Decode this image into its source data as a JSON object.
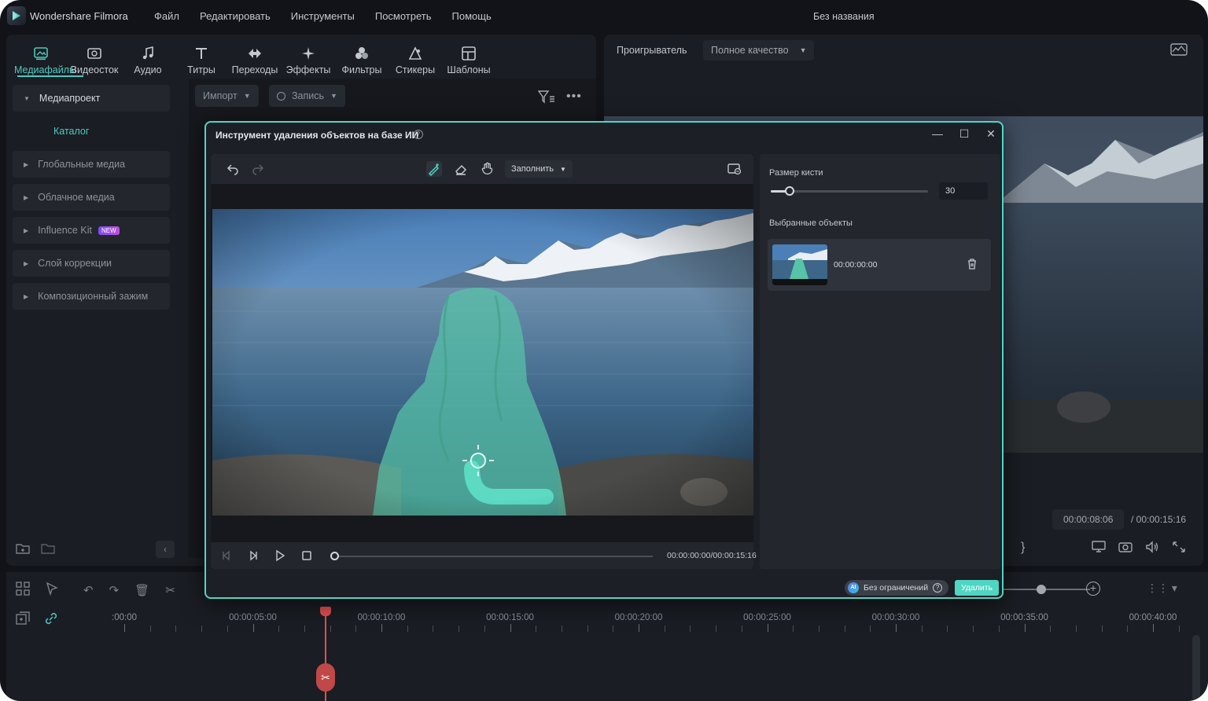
{
  "app": {
    "name": "Wondershare Filmora",
    "menu": [
      "Файл",
      "Редактировать",
      "Инструменты",
      "Посмотреть",
      "Помощь"
    ],
    "doc_title": "Без названия"
  },
  "toolbar_tabs": [
    {
      "label": "Медиафайлы",
      "icon": "media-icon",
      "active": true
    },
    {
      "label": "Видеосток",
      "icon": "stock-video-icon"
    },
    {
      "label": "Аудио",
      "icon": "music-note-icon"
    },
    {
      "label": "Титры",
      "icon": "text-icon"
    },
    {
      "label": "Переходы",
      "icon": "transition-icon"
    },
    {
      "label": "Эффекты",
      "icon": "sparkle-icon"
    },
    {
      "label": "Фильтры",
      "icon": "filter-circles-icon"
    },
    {
      "label": "Стикеры",
      "icon": "sticker-icon"
    },
    {
      "label": "Шаблоны",
      "icon": "template-icon"
    }
  ],
  "sidebar": {
    "items": [
      {
        "label": "Медиапроект",
        "expanded": true
      },
      {
        "label": "Каталог",
        "sub": true
      },
      {
        "label": "Глобальные медиа"
      },
      {
        "label": "Облачное медиа"
      },
      {
        "label": "Influence Kit",
        "badge": "NEW"
      },
      {
        "label": "Слой коррекции"
      },
      {
        "label": "Композиционный зажим"
      }
    ]
  },
  "media_toolbar": {
    "import_label": "Импорт",
    "record_label": "Запись"
  },
  "player": {
    "label": "Проигрыватель",
    "quality": "Полное качество",
    "current_time": "00:00:08:06",
    "total_time": "/ 00:00:15:16"
  },
  "dialog": {
    "title": "Инструмент удаления объектов на базе ИИ",
    "fill_mode": "Заполнить",
    "playback_time": "00:00:00:00/00:00:15:16",
    "playback_progress": 0.0,
    "brush_size_label": "Размер кисти",
    "brush_size_value": "30",
    "selected_objects_label": "Выбранные объекты",
    "objects": [
      {
        "time": "00:00:00:00"
      }
    ],
    "unlimited_label": "Без ограничений",
    "ai_badge": "AI",
    "delete_label": "Удалить"
  },
  "timeline": {
    "ruler": [
      ":00:00",
      "00:00:05:00",
      "00:00:10:00",
      "00:00:15:00",
      "00:00:20:00",
      "00:00:25:00",
      "00:00:30:00",
      "00:00:35:00",
      "00:00:40:00"
    ]
  },
  "colors": {
    "accent": "#4ed6c2",
    "background": "#111318",
    "panel": "#1a1d23",
    "playhead": "#e05050"
  }
}
